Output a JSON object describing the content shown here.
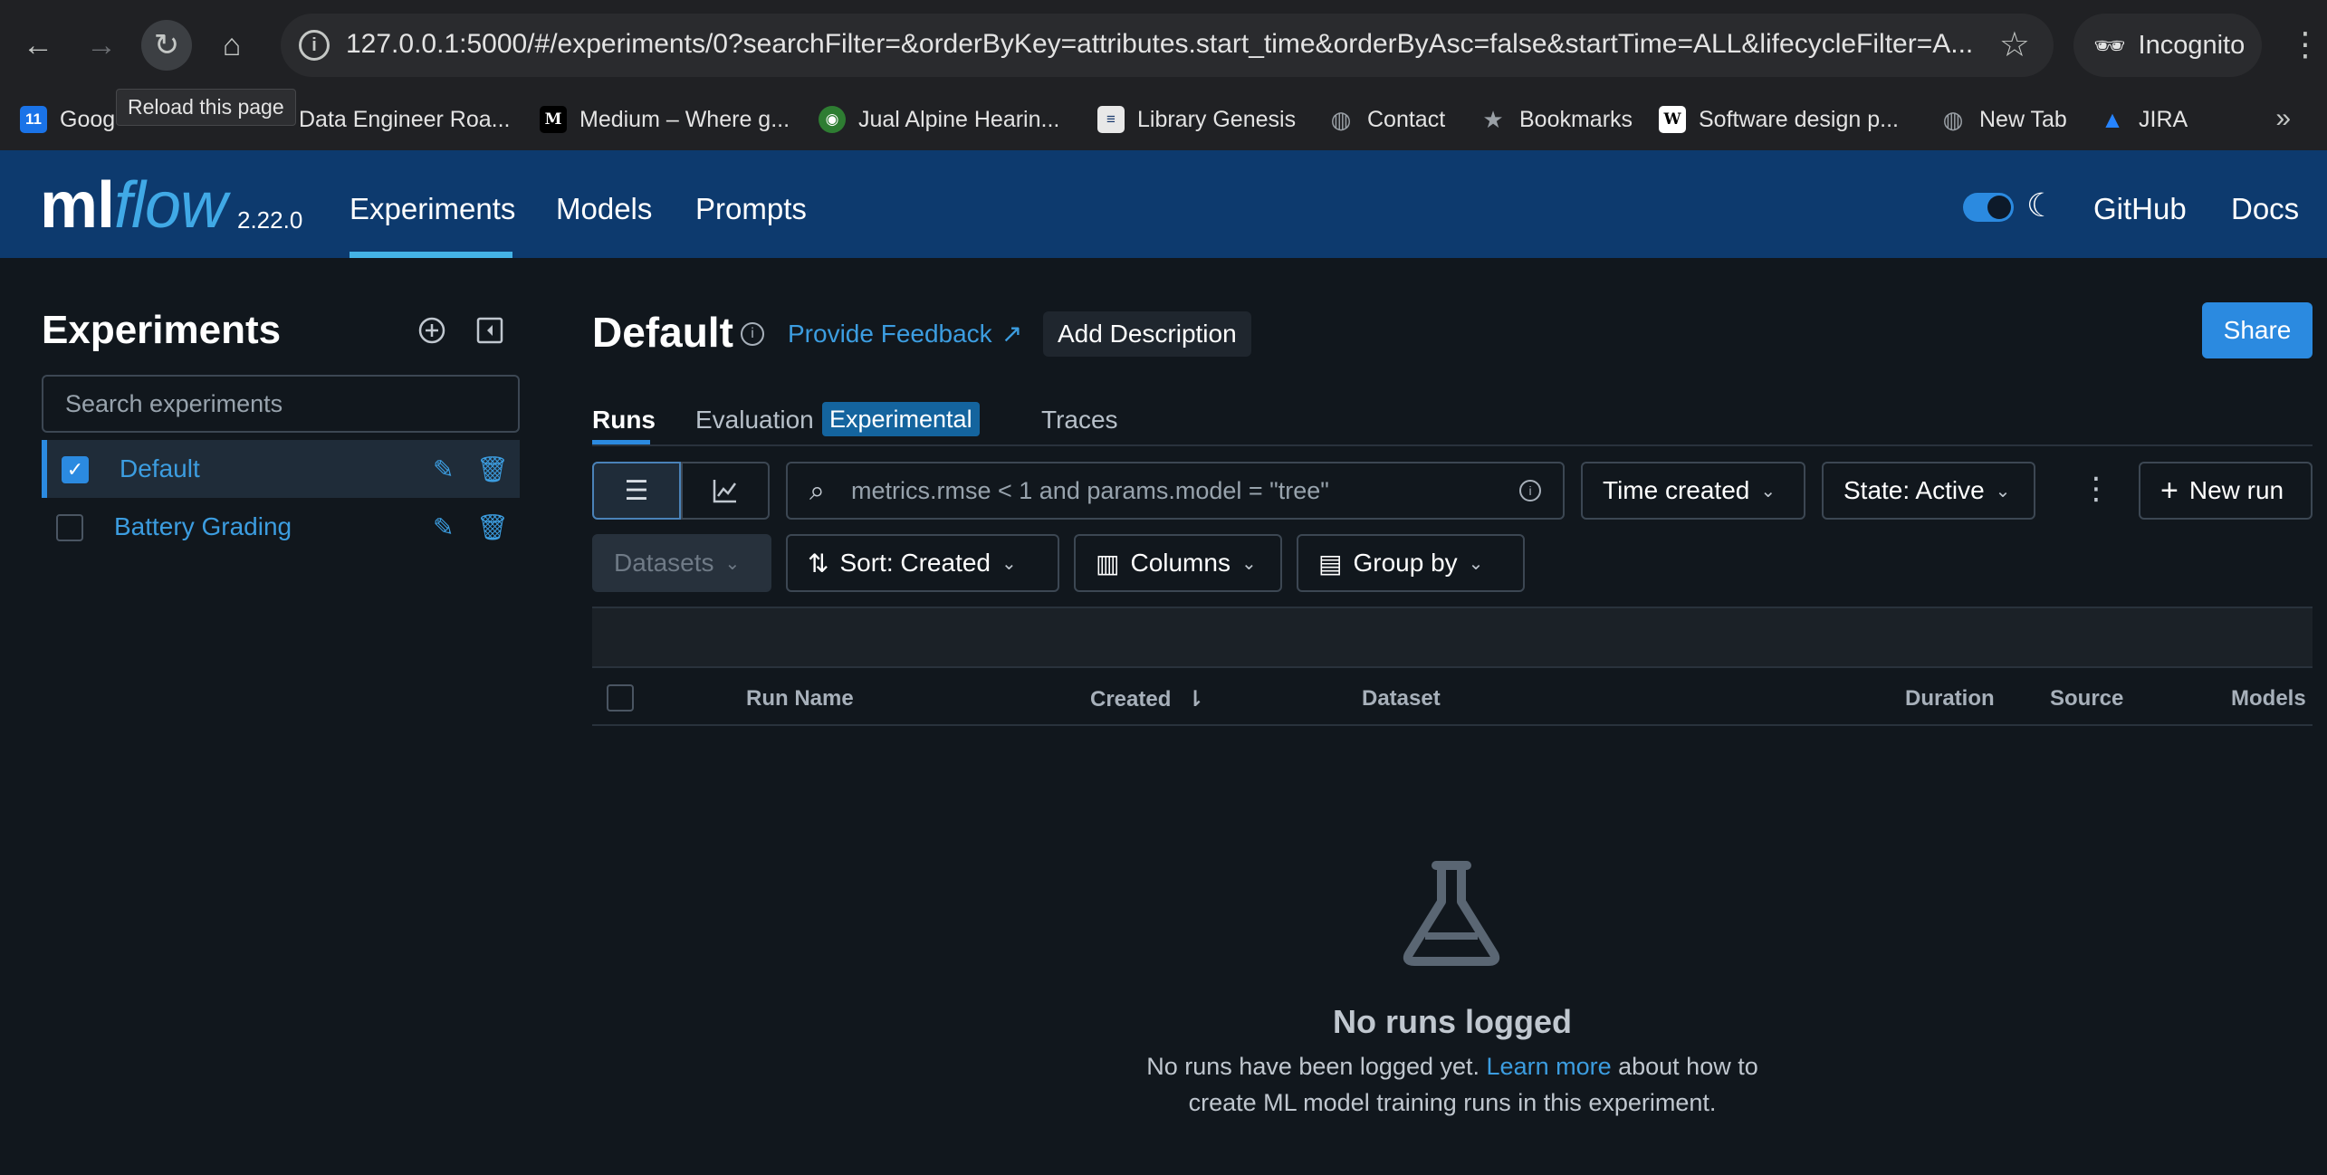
{
  "browser": {
    "url": "127.0.0.1:5000/#/experiments/0?searchFilter=&orderByKey=attributes.start_time&orderByAsc=false&startTime=ALL&lifecycleFilter=A...",
    "profile": "Incognito",
    "tooltip": "Reload this page",
    "bookmarks": [
      {
        "label": "Goog",
        "icon": "google-calendar-icon",
        "color": "#1a73e8"
      },
      {
        "label": "Data Engineer Roa...",
        "icon": "globe-icon",
        "color": ""
      },
      {
        "label": "Medium – Where g...",
        "icon": "medium-icon",
        "color": "#000000"
      },
      {
        "label": "Jual Alpine Hearin...",
        "icon": "owl-icon",
        "color": "#2e7d32"
      },
      {
        "label": "Library Genesis",
        "icon": "library-icon",
        "color": "#ffffff"
      },
      {
        "label": "Contact",
        "icon": "globe-icon",
        "color": "#9aa0a6"
      },
      {
        "label": "Bookmarks",
        "icon": "star-icon",
        "color": "#9aa0a6"
      },
      {
        "label": "Software design p...",
        "icon": "wikipedia-icon",
        "color": "#ffffff"
      },
      {
        "label": "New Tab",
        "icon": "globe-icon",
        "color": "#9aa0a6"
      },
      {
        "label": "JIRA",
        "icon": "jira-icon",
        "color": "#2684ff"
      }
    ]
  },
  "header": {
    "logo_ml": "ml",
    "logo_flow": "flow",
    "version": "2.22.0",
    "nav": [
      "Experiments",
      "Models",
      "Prompts"
    ],
    "links": [
      "GitHub",
      "Docs"
    ],
    "accent": "#0d3a6e"
  },
  "sidebar": {
    "title": "Experiments",
    "search_placeholder": "Search experiments",
    "experiments": [
      {
        "name": "Default",
        "checked": true
      },
      {
        "name": "Battery Grading",
        "checked": false
      }
    ]
  },
  "main": {
    "title": "Default",
    "feedback": "Provide Feedback",
    "add_description": "Add Description",
    "share": "Share",
    "tabs": {
      "runs": "Runs",
      "evaluation": "Evaluation",
      "experimental": "Experimental",
      "traces": "Traces"
    },
    "filter_placeholder": "metrics.rmse < 1 and params.model = \"tree\"",
    "time_created": "Time created",
    "state": "State: Active",
    "new_run": "New run",
    "datasets": "Datasets",
    "sort": "Sort: Created",
    "columns": "Columns",
    "group_by": "Group by",
    "table_columns": [
      "Run Name",
      "Created",
      "Dataset",
      "Duration",
      "Source",
      "Models"
    ],
    "empty": {
      "title": "No runs logged",
      "text_before": "No runs have been logged yet. ",
      "link": "Learn more",
      "text_after": " about how to create ML model training runs in this experiment."
    }
  }
}
